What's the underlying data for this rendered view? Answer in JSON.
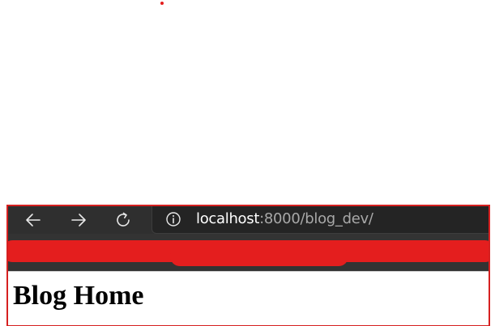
{
  "browser": {
    "nav": {
      "back_icon": "arrow-left-icon",
      "forward_icon": "arrow-right-icon",
      "reload_icon": "reload-icon"
    },
    "address_bar": {
      "info_icon": "info-icon",
      "url_host": "localhost",
      "url_rest": ":8000/blog_dev/"
    }
  },
  "page": {
    "heading": "Blog Home"
  },
  "colors": {
    "annotation_red": "#e41e1e",
    "toolbar_bg": "#2f2f2f",
    "address_bg": "#242424"
  }
}
